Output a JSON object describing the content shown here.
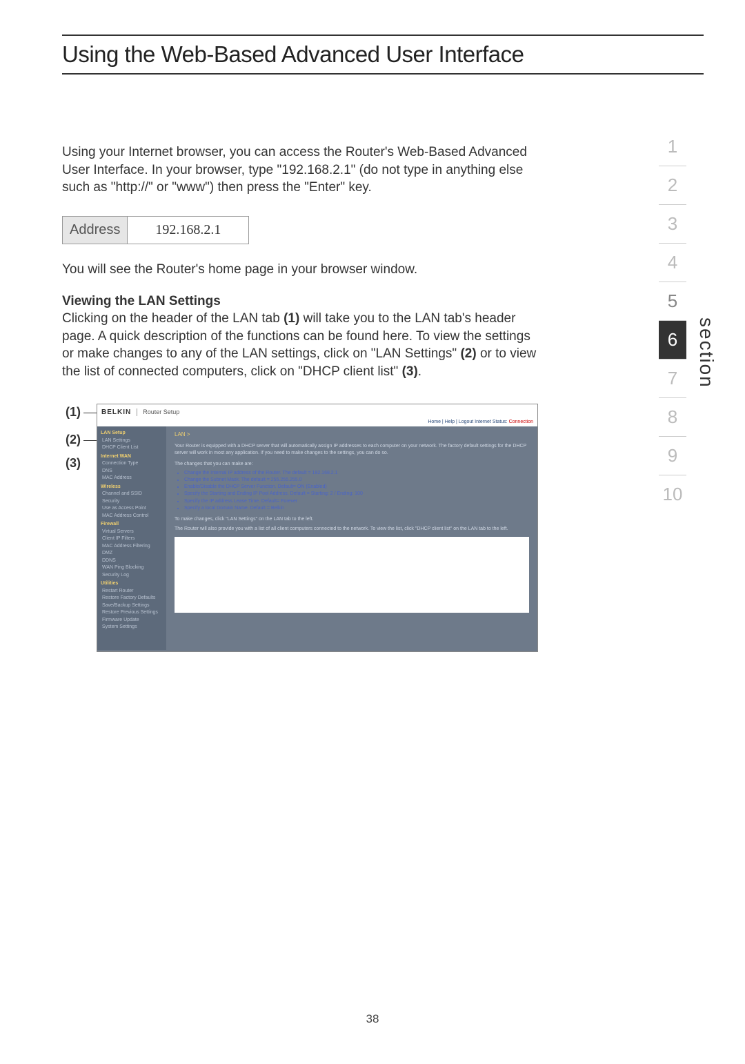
{
  "title": "Using the Web-Based Advanced User Interface",
  "intro": "Using your Internet browser, you can access the Router's Web-Based Advanced User Interface. In your browser, type \"192.168.2.1\" (do not type in anything else such as \"http://\" or \"www\") then press the \"Enter\" key.",
  "address_label": "Address",
  "address_value": "192.168.2.1",
  "after_address": "You will see the Router's home page in your browser window.",
  "subhead": "Viewing the LAN Settings",
  "lan_para_1": "Clicking on the header of the LAN tab ",
  "lan_b1": "(1)",
  "lan_para_2": " will take you to the LAN tab's header page. A quick description of the functions can be found here. To view the settings or make changes to any of the LAN settings, click on \"LAN Settings\" ",
  "lan_b2": "(2)",
  "lan_para_3": " or to view the list of connected computers, click on \"DHCP client list\" ",
  "lan_b3": "(3)",
  "lan_para_4": ".",
  "callouts": {
    "c1": "(1)",
    "c2": "(2)",
    "c3": "(3)"
  },
  "section_label": "section",
  "section_nav": [
    "1",
    "2",
    "3",
    "4",
    "5",
    "6",
    "7",
    "8",
    "9",
    "10"
  ],
  "page_number": "38",
  "router": {
    "brand": "BELKIN",
    "setup": "Router Setup",
    "top_links": "Home | Help | Logout   Internet Status: ",
    "top_status": "Connection",
    "side": [
      {
        "cat": "LAN Setup"
      },
      {
        "item": "LAN Settings"
      },
      {
        "item": "DHCP Client List"
      },
      {
        "cat": "Internet WAN"
      },
      {
        "item": "Connection Type"
      },
      {
        "item": "DNS"
      },
      {
        "item": "MAC Address"
      },
      {
        "cat": "Wireless"
      },
      {
        "item": "Channel and SSID"
      },
      {
        "item": "Security"
      },
      {
        "item": "Use as Access Point"
      },
      {
        "item": "MAC Address Control"
      },
      {
        "cat": "Firewall"
      },
      {
        "item": "Virtual Servers"
      },
      {
        "item": "Client IP Filters"
      },
      {
        "item": "MAC Address Filtering"
      },
      {
        "item": "DMZ"
      },
      {
        "item": "DDNS"
      },
      {
        "item": "WAN Ping Blocking"
      },
      {
        "item": "Security Log"
      },
      {
        "cat": "Utilities"
      },
      {
        "item": "Restart Router"
      },
      {
        "item": "Restore Factory Defaults"
      },
      {
        "item": "Save/Backup Settings"
      },
      {
        "item": "Restore Previous Settings"
      },
      {
        "item": "Firmware Update"
      },
      {
        "item": "System Settings"
      }
    ],
    "lan_crumb": "LAN >",
    "main_intro": "Your Router is equipped with a DHCP server that will automatically assign IP addresses to each computer on your network. The factory default settings for the DHCP server will work in most any application. If you need to make changes to the settings, you can do so.",
    "changes_label": "The changes that you can make are:",
    "bullets": [
      "Change the Internal IP address of the Router. The default = 192.168.2.1",
      "Change the Subnet Mask. The default = 255.255.255.0",
      "Enable/Disable the DHCP Server Function. Default= ON (Enabled)",
      "Specify the Starting and Ending IP Pool Address. Default = Starting: 2 / Ending: 100",
      "Specify the IP address Lease Time. Default= Forever",
      "Specify a local Domain Name. Default = Belkin"
    ],
    "main_after1": "To make changes, click \"LAN Settings\" on the LAN tab to the left.",
    "main_after2": "The Router will also provide you with a list of all client computers connected to the network. To view the list, click \"DHCP client list\" on the LAN tab to the left."
  }
}
